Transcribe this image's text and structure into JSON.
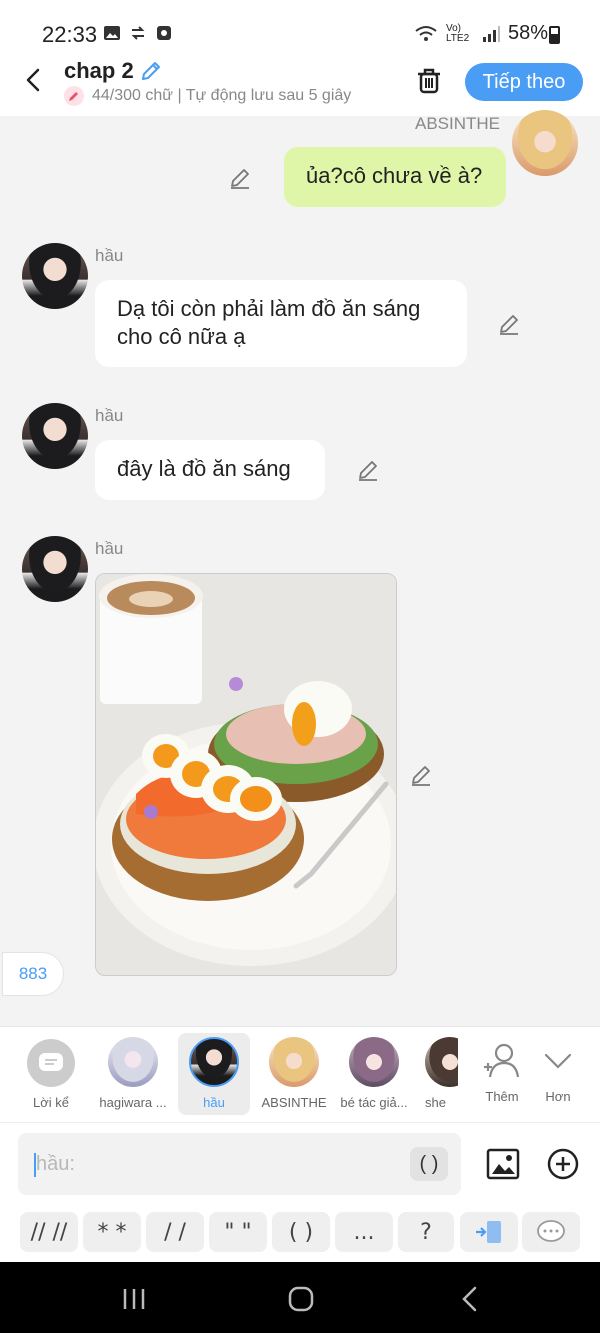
{
  "status_bar": {
    "time": "22:33",
    "signal_text": "Vo) LTE2",
    "battery": "58%"
  },
  "header": {
    "title": "chap 2",
    "subtitle": "44/300 chữ | Tự động lưu sau 5 giây",
    "next_label": "Tiếp theo"
  },
  "messages": [
    {
      "sender": "ABSINTHE",
      "text": "ủa?cô chưa về à?"
    },
    {
      "sender": "hầu",
      "text": "Dạ tôi còn phải làm đồ ăn sáng cho cô nữa ạ"
    },
    {
      "sender": "hầu",
      "text": "đây là đồ ăn sáng"
    },
    {
      "sender": "hầu",
      "image": "breakfast-photo"
    }
  ],
  "count_pill": "883",
  "characters": [
    {
      "label": "Lời kể"
    },
    {
      "label": "hagiwara ..."
    },
    {
      "label": "hầu"
    },
    {
      "label": "ABSINTHE"
    },
    {
      "label": "bé tác giả..."
    },
    {
      "label": "she"
    },
    {
      "label": "Thêm"
    },
    {
      "label": "Hơn"
    }
  ],
  "input": {
    "placeholder": "hầu:",
    "paren_chip": "( )"
  },
  "quick_chips": [
    "// //",
    "* *",
    "/ /",
    "\" \"",
    "( )",
    "...",
    "?"
  ],
  "colors": {
    "accent": "#4a9df5",
    "my_bubble": "#dff6a8"
  }
}
